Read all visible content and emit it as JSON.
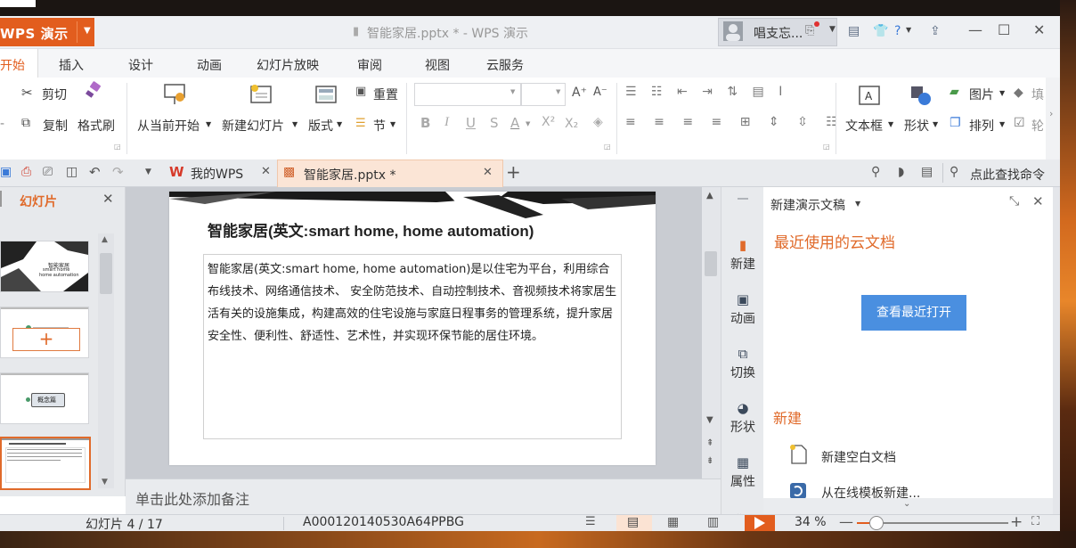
{
  "window": {
    "app_button": "WPS 演示",
    "doc_title": "智能家居.pptx * - WPS 演示",
    "user_name": "唱支忘..."
  },
  "ribbon_tabs": [
    "开始",
    "插入",
    "设计",
    "动画",
    "幻灯片放映",
    "审阅",
    "视图",
    "云服务"
  ],
  "ribbon": {
    "cut": "剪切",
    "copy": "复制",
    "format_painter": "格式刷",
    "from_current": "从当前开始",
    "new_slide": "新建幻灯片",
    "layout": "版式",
    "reset": "重置",
    "section": "节",
    "textbox": "文本框",
    "shape": "形状",
    "picture": "图片",
    "arrange": "排列",
    "fill": "填",
    "outline": "轮"
  },
  "doc_tabs": {
    "my_wps": "我的WPS",
    "file": "智能家居.pptx *",
    "search_cmd": "点此查找命令"
  },
  "slides_panel": {
    "title": "幻灯片",
    "thumb1_lines": [
      "智能家居",
      "smart home",
      "home automation"
    ],
    "thumb3_text": "概念篇"
  },
  "slide": {
    "title": "智能家居(英文:smart home, home automation)",
    "body": "智能家居(英文:smart home, home automation)是以住宅为平台，利用综合布线技术、网络通信技术、 安全防范技术、自动控制技术、音视频技术将家居生活有关的设施集成，构建高效的住宅设施与家庭日程事务的管理系统，提升家居安全性、便利性、舒适性、艺术性，并实现环保节能的居住环境。"
  },
  "notes_placeholder": "单击此处添加备注",
  "side_bar": [
    "新建",
    "动画",
    "切换",
    "形状",
    "属性"
  ],
  "task_pane": {
    "title": "新建演示文稿",
    "recent_heading": "最近使用的云文档",
    "open_recent": "查看最近打开",
    "new_heading": "新建",
    "new_blank": "新建空白文档",
    "from_template": "从在线模板新建..."
  },
  "status": {
    "slide_counter": "幻灯片 4 / 17",
    "template_id": "A000120140530A64PPBG",
    "zoom": "34 %"
  },
  "colors": {
    "accent": "#e25d1e",
    "button_blue": "#4a8fe0"
  }
}
